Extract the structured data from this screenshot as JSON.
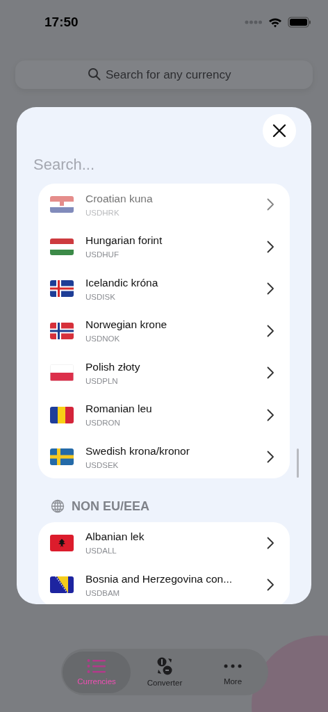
{
  "status_bar": {
    "time": "17:50"
  },
  "search_bar": {
    "placeholder": "Search for any currency"
  },
  "modal": {
    "search": {
      "placeholder": "Search..."
    },
    "sections": [
      {
        "rows": [
          {
            "name": "Croatian kuna",
            "code": "USDHRK",
            "kind": "croatia",
            "faded": true
          },
          {
            "name": "Hungarian forint",
            "code": "USDHUF",
            "kind": "hungary",
            "faded": false
          },
          {
            "name": "Icelandic króna",
            "code": "USDISK",
            "kind": "iceland",
            "faded": false
          },
          {
            "name": "Norwegian krone",
            "code": "USDNOK",
            "kind": "norway",
            "faded": false
          },
          {
            "name": "Polish złoty",
            "code": "USDPLN",
            "kind": "poland",
            "faded": false
          },
          {
            "name": "Romanian leu",
            "code": "USDRON",
            "kind": "romania",
            "faded": false
          },
          {
            "name": "Swedish krona/kronor",
            "code": "USDSEK",
            "kind": "sweden",
            "faded": false
          }
        ]
      },
      {
        "title": "NON EU/EEA",
        "rows": [
          {
            "name": "Albanian lek",
            "code": "USDALL",
            "kind": "albania",
            "faded": false
          },
          {
            "name": "Bosnia and Herzegovina con...",
            "code": "USDBAM",
            "kind": "bosnia",
            "faded": false
          }
        ]
      }
    ]
  },
  "tab_bar": {
    "tabs": [
      {
        "label": "Currencies",
        "selected": true
      },
      {
        "label": "Converter",
        "selected": false
      },
      {
        "label": "More",
        "selected": false
      }
    ]
  }
}
